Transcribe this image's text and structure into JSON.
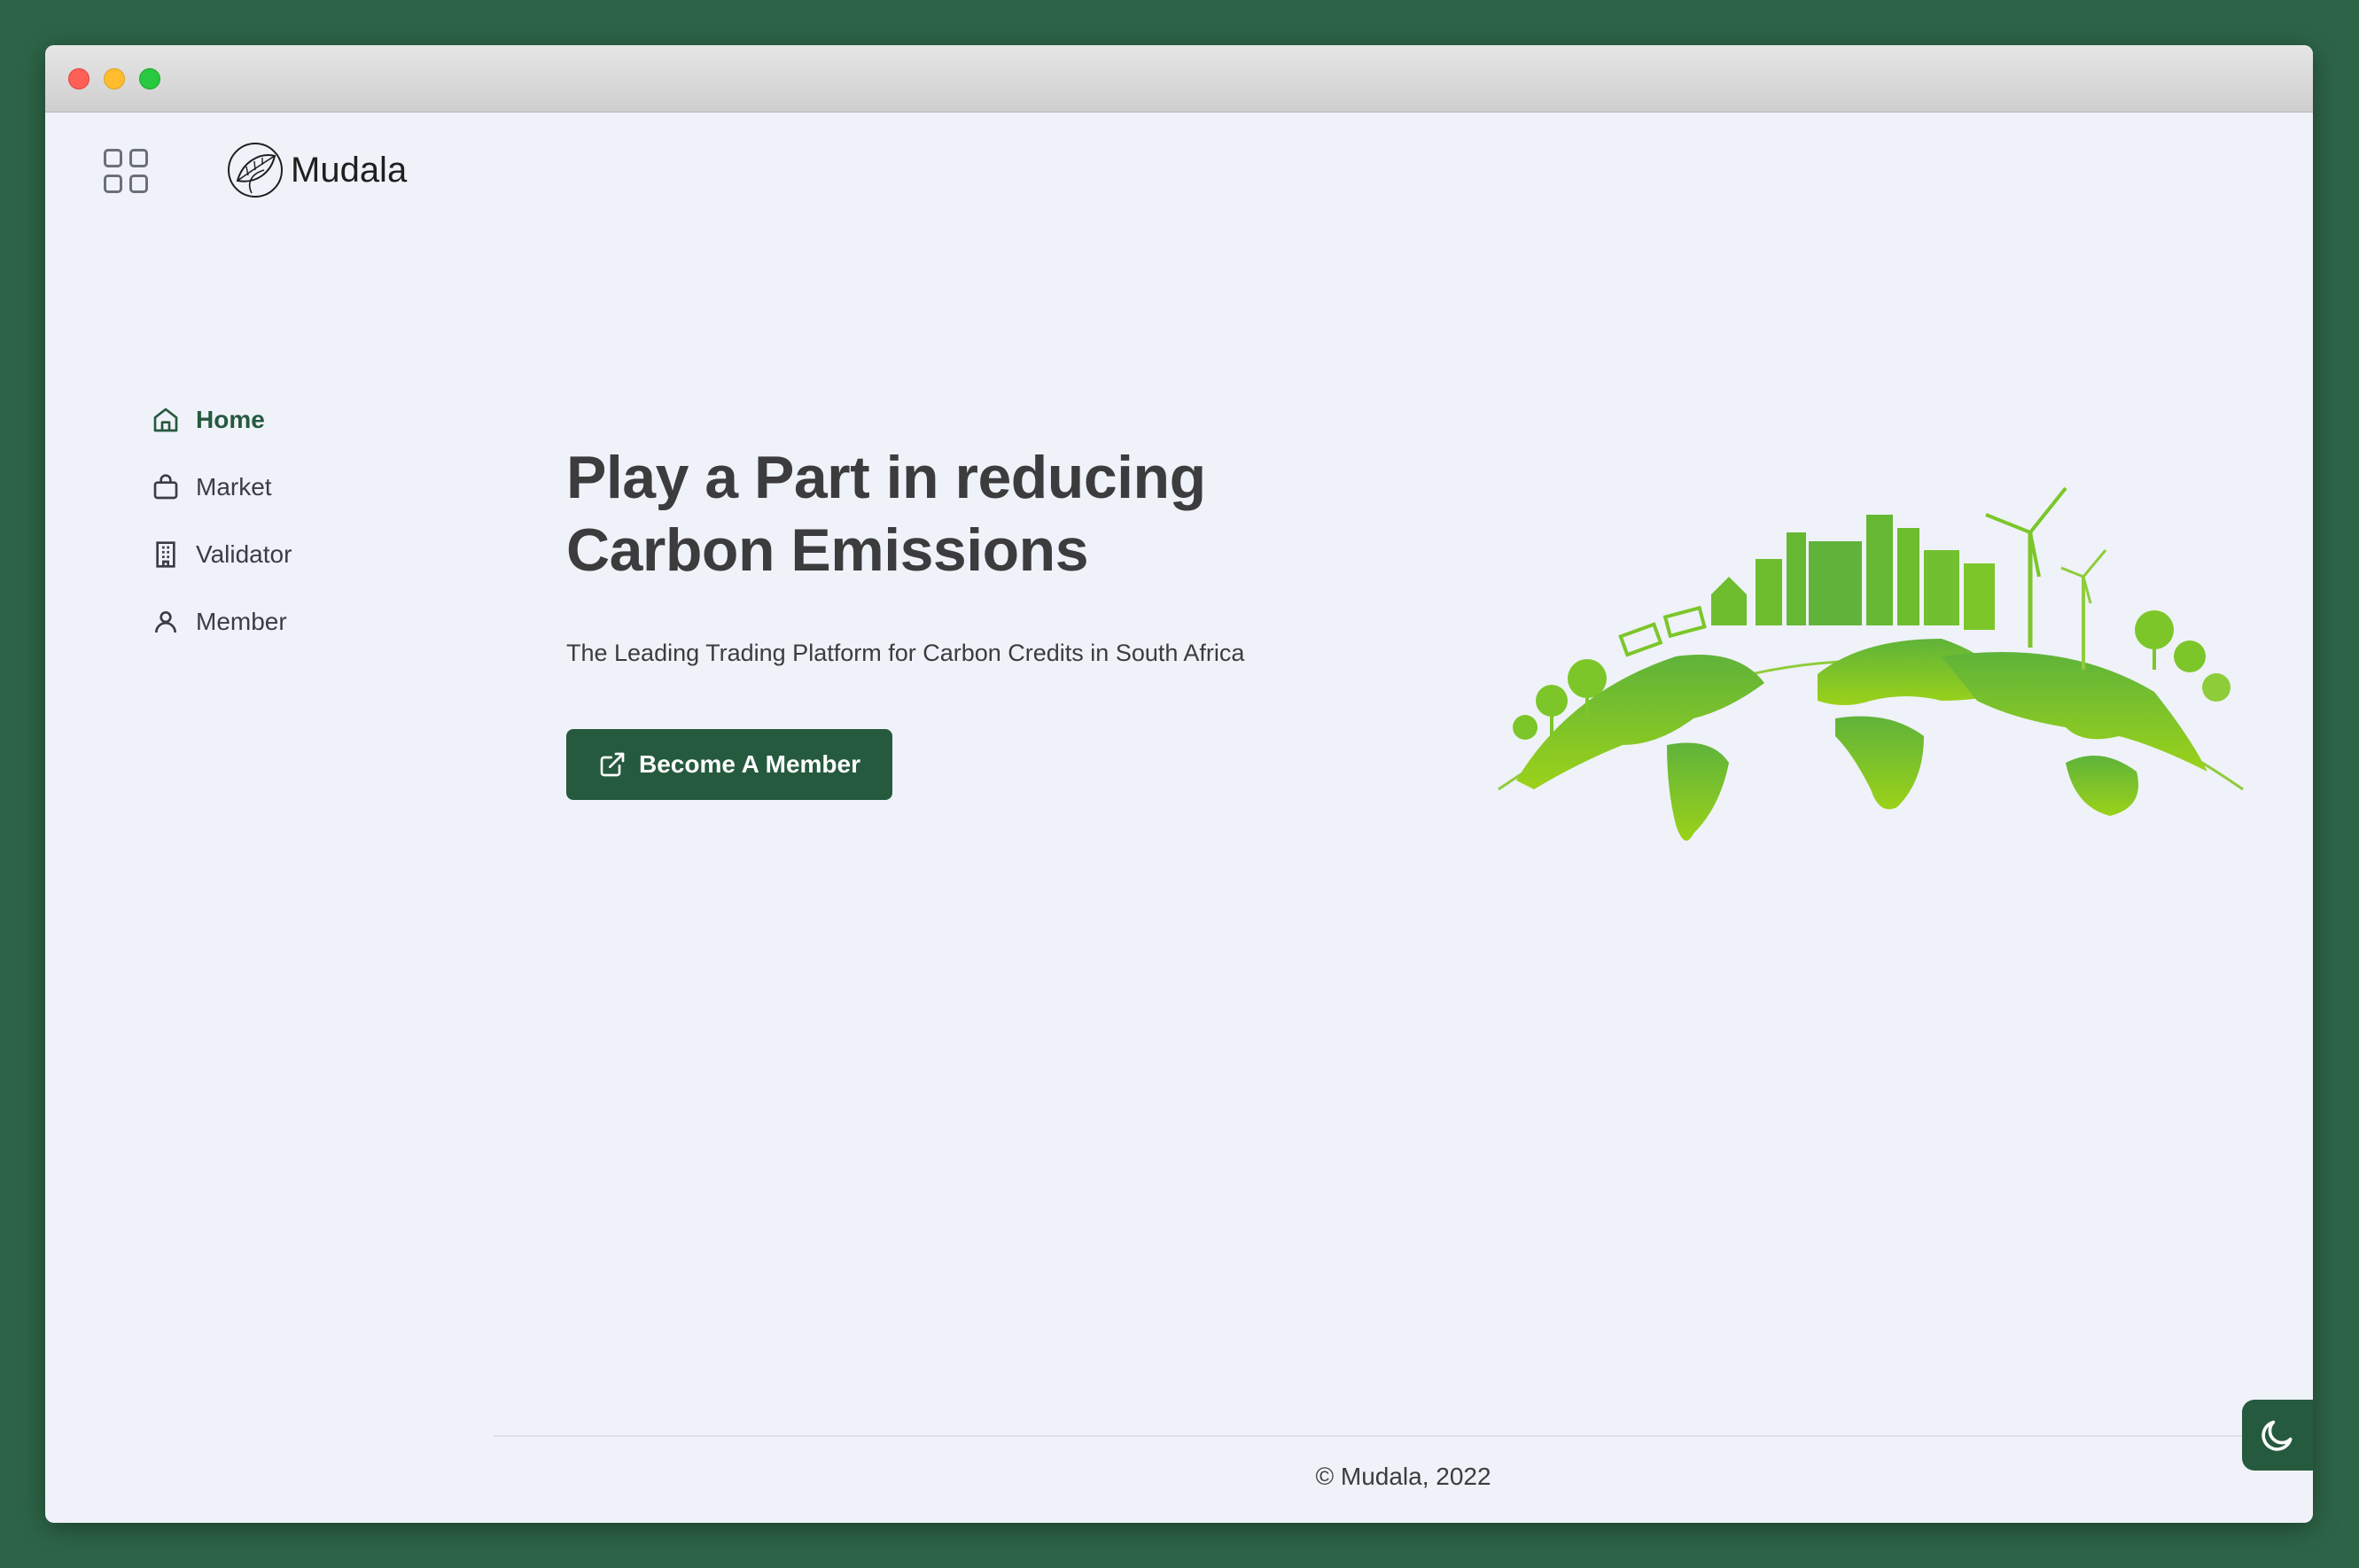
{
  "app": {
    "brand": "Mudala"
  },
  "nav": {
    "items": [
      {
        "label": "Home",
        "icon": "home-icon",
        "active": true
      },
      {
        "label": "Market",
        "icon": "shopping-bag-icon",
        "active": false
      },
      {
        "label": "Validator",
        "icon": "building-icon",
        "active": false
      },
      {
        "label": "Member",
        "icon": "user-icon",
        "active": false
      }
    ]
  },
  "hero": {
    "title_line1": "Play a Part in reducing",
    "title_line2": "Carbon Emissions",
    "subtitle": "The Leading Trading Platform for Carbon Credits in South Africa",
    "cta_label": "Become A Member",
    "cta_icon": "external-link-icon"
  },
  "footer": {
    "copyright": "© Mudala, 2022"
  },
  "colors": {
    "primary": "#265a3e",
    "background": "#eff2f8",
    "outer": "#2d6447",
    "earth_green": "#7cc62a"
  }
}
